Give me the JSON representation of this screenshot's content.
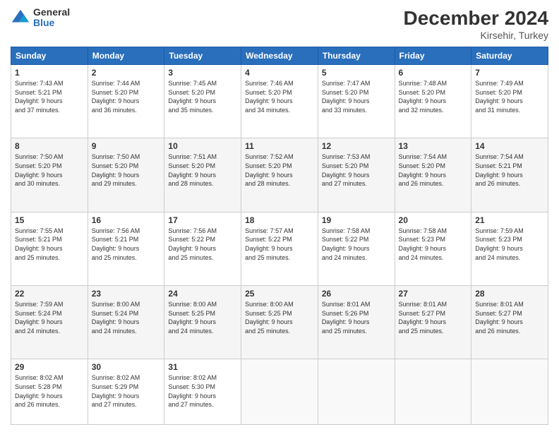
{
  "logo": {
    "general": "General",
    "blue": "Blue"
  },
  "header": {
    "title": "December 2024",
    "location": "Kirsehir, Turkey"
  },
  "days_header": [
    "Sunday",
    "Monday",
    "Tuesday",
    "Wednesday",
    "Thursday",
    "Friday",
    "Saturday"
  ],
  "weeks": [
    [
      {
        "num": "1",
        "info": "Sunrise: 7:43 AM\nSunset: 5:21 PM\nDaylight: 9 hours\nand 37 minutes."
      },
      {
        "num": "2",
        "info": "Sunrise: 7:44 AM\nSunset: 5:20 PM\nDaylight: 9 hours\nand 36 minutes."
      },
      {
        "num": "3",
        "info": "Sunrise: 7:45 AM\nSunset: 5:20 PM\nDaylight: 9 hours\nand 35 minutes."
      },
      {
        "num": "4",
        "info": "Sunrise: 7:46 AM\nSunset: 5:20 PM\nDaylight: 9 hours\nand 34 minutes."
      },
      {
        "num": "5",
        "info": "Sunrise: 7:47 AM\nSunset: 5:20 PM\nDaylight: 9 hours\nand 33 minutes."
      },
      {
        "num": "6",
        "info": "Sunrise: 7:48 AM\nSunset: 5:20 PM\nDaylight: 9 hours\nand 32 minutes."
      },
      {
        "num": "7",
        "info": "Sunrise: 7:49 AM\nSunset: 5:20 PM\nDaylight: 9 hours\nand 31 minutes."
      }
    ],
    [
      {
        "num": "8",
        "info": "Sunrise: 7:50 AM\nSunset: 5:20 PM\nDaylight: 9 hours\nand 30 minutes."
      },
      {
        "num": "9",
        "info": "Sunrise: 7:50 AM\nSunset: 5:20 PM\nDaylight: 9 hours\nand 29 minutes."
      },
      {
        "num": "10",
        "info": "Sunrise: 7:51 AM\nSunset: 5:20 PM\nDaylight: 9 hours\nand 28 minutes."
      },
      {
        "num": "11",
        "info": "Sunrise: 7:52 AM\nSunset: 5:20 PM\nDaylight: 9 hours\nand 28 minutes."
      },
      {
        "num": "12",
        "info": "Sunrise: 7:53 AM\nSunset: 5:20 PM\nDaylight: 9 hours\nand 27 minutes."
      },
      {
        "num": "13",
        "info": "Sunrise: 7:54 AM\nSunset: 5:20 PM\nDaylight: 9 hours\nand 26 minutes."
      },
      {
        "num": "14",
        "info": "Sunrise: 7:54 AM\nSunset: 5:21 PM\nDaylight: 9 hours\nand 26 minutes."
      }
    ],
    [
      {
        "num": "15",
        "info": "Sunrise: 7:55 AM\nSunset: 5:21 PM\nDaylight: 9 hours\nand 25 minutes."
      },
      {
        "num": "16",
        "info": "Sunrise: 7:56 AM\nSunset: 5:21 PM\nDaylight: 9 hours\nand 25 minutes."
      },
      {
        "num": "17",
        "info": "Sunrise: 7:56 AM\nSunset: 5:22 PM\nDaylight: 9 hours\nand 25 minutes."
      },
      {
        "num": "18",
        "info": "Sunrise: 7:57 AM\nSunset: 5:22 PM\nDaylight: 9 hours\nand 25 minutes."
      },
      {
        "num": "19",
        "info": "Sunrise: 7:58 AM\nSunset: 5:22 PM\nDaylight: 9 hours\nand 24 minutes."
      },
      {
        "num": "20",
        "info": "Sunrise: 7:58 AM\nSunset: 5:23 PM\nDaylight: 9 hours\nand 24 minutes."
      },
      {
        "num": "21",
        "info": "Sunrise: 7:59 AM\nSunset: 5:23 PM\nDaylight: 9 hours\nand 24 minutes."
      }
    ],
    [
      {
        "num": "22",
        "info": "Sunrise: 7:59 AM\nSunset: 5:24 PM\nDaylight: 9 hours\nand 24 minutes."
      },
      {
        "num": "23",
        "info": "Sunrise: 8:00 AM\nSunset: 5:24 PM\nDaylight: 9 hours\nand 24 minutes."
      },
      {
        "num": "24",
        "info": "Sunrise: 8:00 AM\nSunset: 5:25 PM\nDaylight: 9 hours\nand 24 minutes."
      },
      {
        "num": "25",
        "info": "Sunrise: 8:00 AM\nSunset: 5:25 PM\nDaylight: 9 hours\nand 25 minutes."
      },
      {
        "num": "26",
        "info": "Sunrise: 8:01 AM\nSunset: 5:26 PM\nDaylight: 9 hours\nand 25 minutes."
      },
      {
        "num": "27",
        "info": "Sunrise: 8:01 AM\nSunset: 5:27 PM\nDaylight: 9 hours\nand 25 minutes."
      },
      {
        "num": "28",
        "info": "Sunrise: 8:01 AM\nSunset: 5:27 PM\nDaylight: 9 hours\nand 26 minutes."
      }
    ],
    [
      {
        "num": "29",
        "info": "Sunrise: 8:02 AM\nSunset: 5:28 PM\nDaylight: 9 hours\nand 26 minutes."
      },
      {
        "num": "30",
        "info": "Sunrise: 8:02 AM\nSunset: 5:29 PM\nDaylight: 9 hours\nand 27 minutes."
      },
      {
        "num": "31",
        "info": "Sunrise: 8:02 AM\nSunset: 5:30 PM\nDaylight: 9 hours\nand 27 minutes."
      },
      {
        "num": "",
        "info": ""
      },
      {
        "num": "",
        "info": ""
      },
      {
        "num": "",
        "info": ""
      },
      {
        "num": "",
        "info": ""
      }
    ]
  ]
}
